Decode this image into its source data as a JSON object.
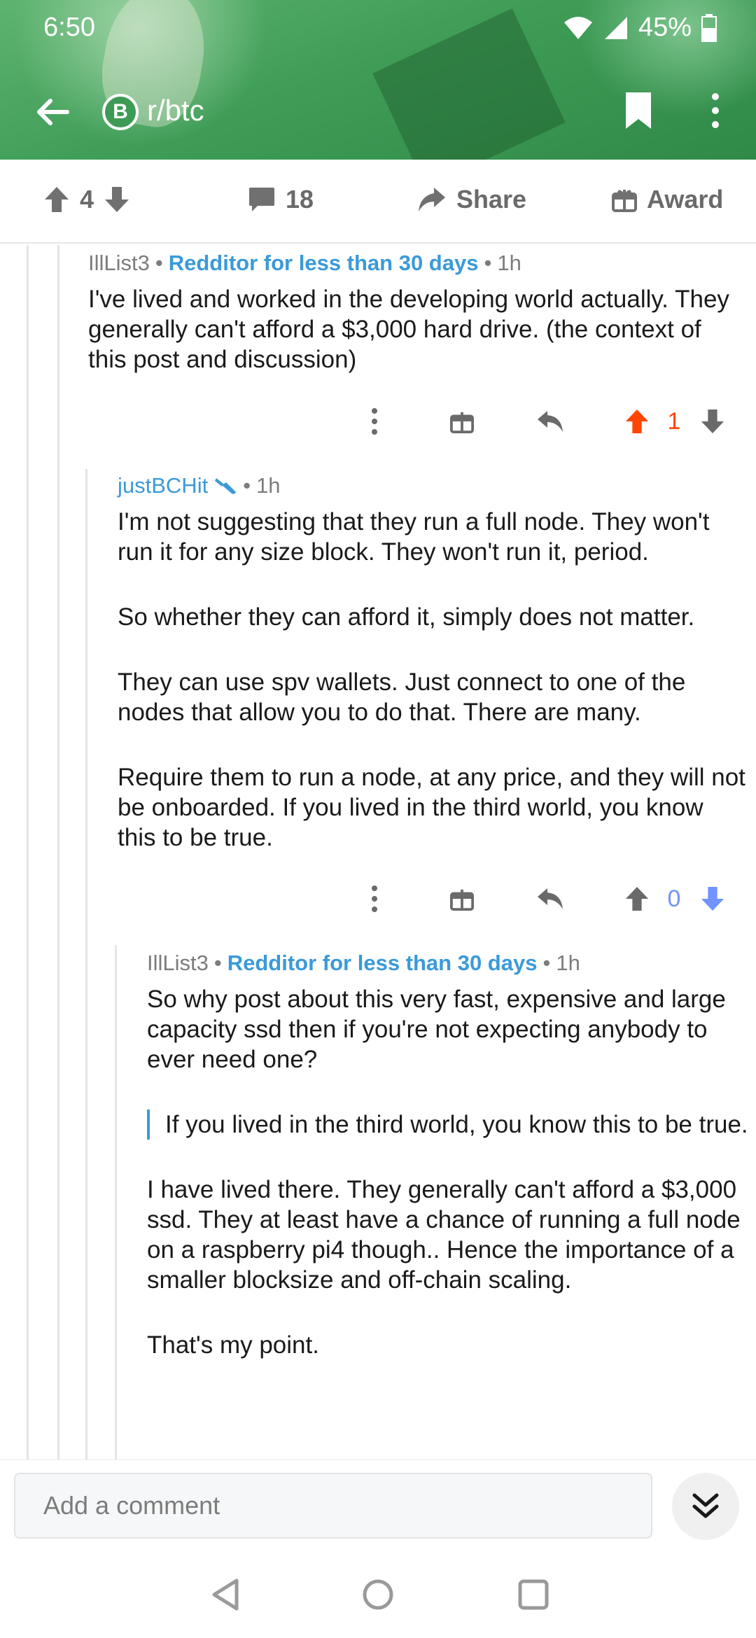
{
  "status": {
    "time": "6:50",
    "battery": "45%"
  },
  "toolbar": {
    "subreddit": "r/btc",
    "sub_icon_glyph": "B"
  },
  "post_actions": {
    "score": "4",
    "comments": "18",
    "share_label": "Share",
    "award_label": "Award"
  },
  "comments": [
    {
      "author": "IllList3",
      "flair": "Redditor for less than 30 days",
      "time": "1h",
      "paragraphs": [
        "I've lived and worked in the developing world actually. They generally can't afford a $3,000 hard drive. (the context of this post and discussion)"
      ],
      "score": "1",
      "vote_state": "up"
    },
    {
      "author": "justBCHit",
      "time": "1h",
      "paragraphs": [
        "I'm not suggesting that they run a full node. They won't run it for any size block. They won't run it, period.",
        "So whether they can afford it, simply does not matter.",
        "They can use spv wallets. Just connect to one of the nodes that allow you to do that. There are many.",
        "Require them to run a node, at any price, and they will not be onboarded. If you lived in the third world, you know this to be true."
      ],
      "score": "0",
      "vote_state": "down"
    },
    {
      "author": "IllList3",
      "flair": "Redditor for less than 30 days",
      "time": "1h",
      "paragraph1": "So why post about this very fast, expensive and large capacity ssd then if you're not expecting anybody to ever need one?",
      "quote": "If you lived in the third world, you know this to be true.",
      "paragraph2": "I have lived there.  They generally can't afford a $3,000 ssd.  They at least have a chance of running a full node on a raspberry pi4 though..  Hence the importance of a smaller blocksize and off-chain scaling.",
      "paragraph3": "That's my point."
    }
  ],
  "comment_bar": {
    "placeholder": "Add a comment"
  },
  "colors": {
    "header_green": "#3e9b55",
    "upvote": "#ff4500",
    "downvote": "#7193ff",
    "link_blue": "#3a9ad9"
  }
}
